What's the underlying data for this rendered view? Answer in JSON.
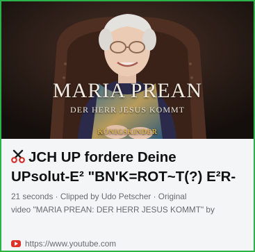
{
  "card": {
    "accent_color": "#2bb34a",
    "thumbnail": {
      "title": "MARIA PREAN",
      "subtitle": "DER HERR JESUS KOMMT",
      "badge": "KÖNIGSKINDER"
    },
    "title_icon": "scissors-icon",
    "title_line_1": "JCH UP fordere Deine",
    "title_line_2": "UPsolut-E² \"BN'K=ROT~T(?) E²R-",
    "meta_line_1": "21 seconds · Clipped by Udo Petscher · Original",
    "meta_line_2": "video \"MARIA PREAN: DER HERR JESUS KOMMT\" by",
    "link_icon": "youtube-icon",
    "link_text": "https://www.youtube.com"
  }
}
